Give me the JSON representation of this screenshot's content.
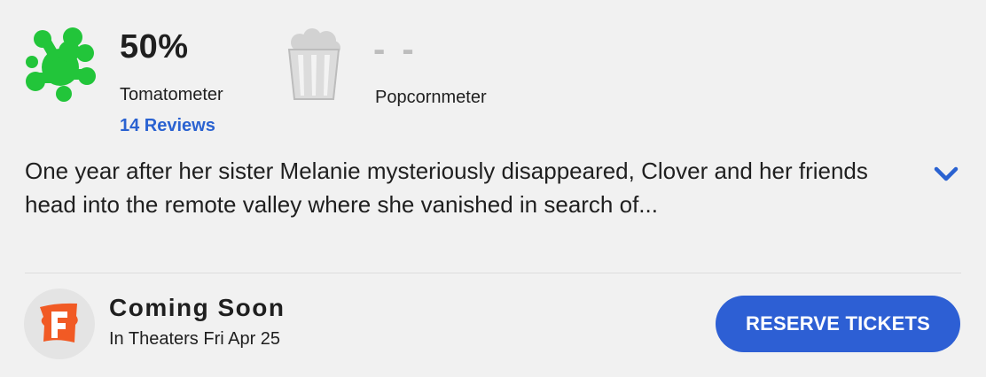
{
  "scores": {
    "tomatometer": {
      "value": "50%",
      "label": "Tomatometer",
      "reviews_link": "14 Reviews",
      "icon": "rotten-splat-icon",
      "icon_color": "#22c53a"
    },
    "popcornmeter": {
      "value": "- -",
      "label": "Popcornmeter",
      "icon": "empty-popcorn-bucket-icon",
      "icon_color": "#c8c8c8"
    }
  },
  "synopsis": {
    "text": "One year after her sister Melanie mysteriously disappeared, Clover and her friends head into the remote valley where she vanished in search of...",
    "expand_icon": "chevron-down-icon"
  },
  "footer": {
    "logo": "fandango-logo",
    "status": "Coming Soon",
    "release": "In Theaters Fri Apr 25",
    "cta_label": "RESERVE TICKETS",
    "cta_color": "#2d5fd4"
  },
  "colors": {
    "link": "#2a62d1",
    "background": "#f1f1f1"
  }
}
